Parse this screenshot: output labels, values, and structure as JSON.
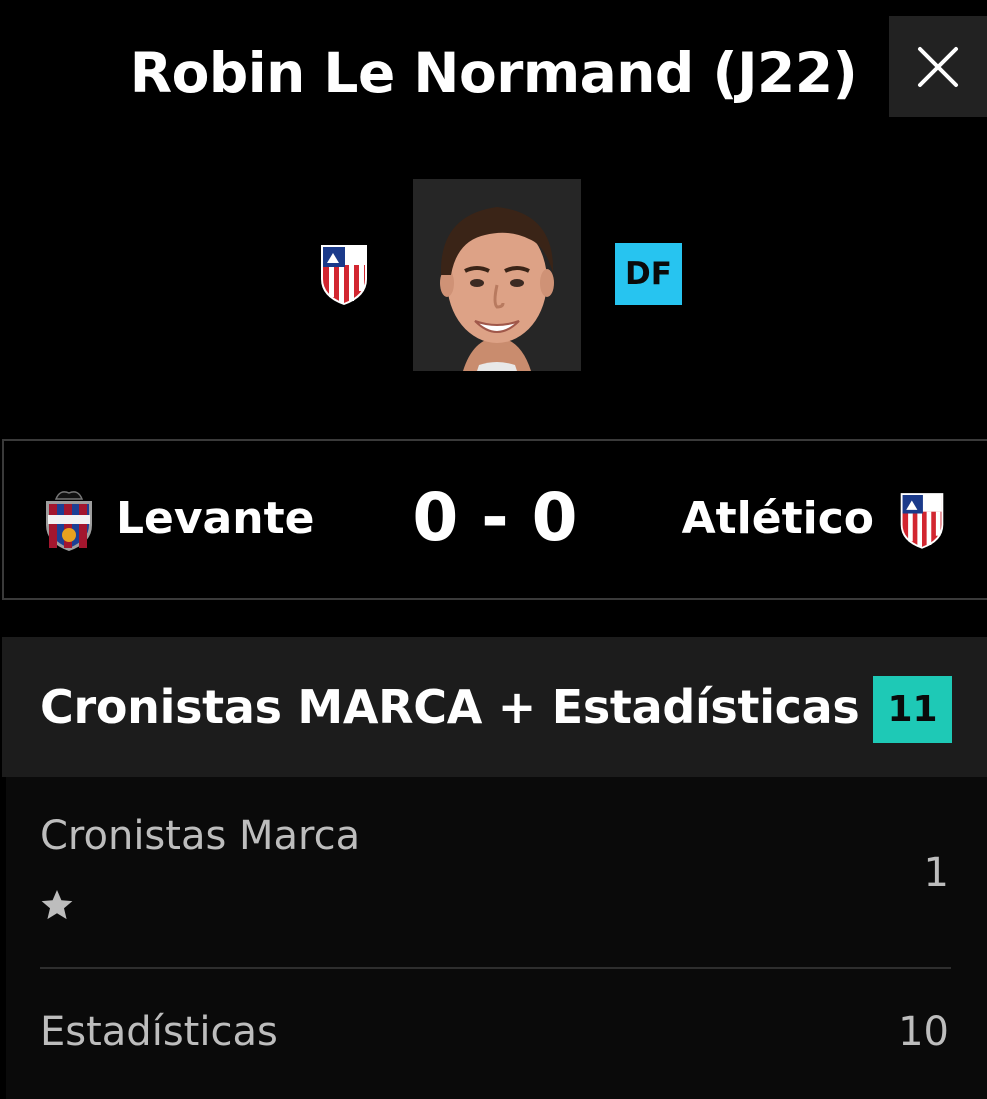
{
  "header": {
    "title": "Robin Le Normand (J22)"
  },
  "player": {
    "team_crest": "atletico-madrid-crest",
    "photo": "player-photo",
    "position": "DF",
    "position_color": "#27c4f0"
  },
  "match": {
    "home_team": "Levante",
    "home_crest": "levante-crest",
    "score": "0 - 0",
    "away_team": "Atlético",
    "away_crest": "atletico-madrid-crest"
  },
  "rating": {
    "title": "Cronistas MARCA + Estadísticas",
    "total": "11",
    "total_color": "#1ec9b6",
    "rows": [
      {
        "label": "Cronistas Marca",
        "value": "1",
        "stars": 1
      },
      {
        "label": "Estadísticas",
        "value": "10"
      }
    ]
  }
}
